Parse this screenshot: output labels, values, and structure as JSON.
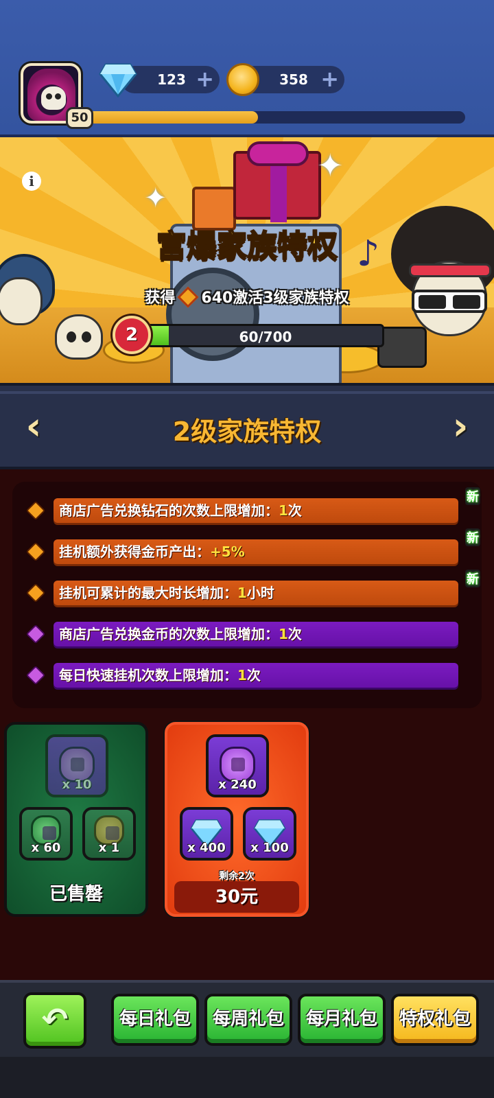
{
  "player": {
    "level": "50",
    "xp_progress": 0.45,
    "diamonds": "123",
    "coins": "358"
  },
  "banner": {
    "title": "宫爆家族特权",
    "obtain_prefix": "获得",
    "obtain_text": "640激活3级家族特权",
    "current_level": "2",
    "progress_text": "60/700",
    "progress_fraction": 0.0857
  },
  "level_header": {
    "title": "2级家族特权"
  },
  "privileges": [
    {
      "text": "商店广告兑换钻石的次数上限增加：",
      "amount": "1",
      "unit": "次",
      "color": "orange",
      "new_label": "新"
    },
    {
      "text": "挂机额外获得金币产出：",
      "amount": "+5",
      "unit": "%",
      "color": "orange",
      "new_label": "新"
    },
    {
      "text": "挂机可累计的最大时长增加：",
      "amount": "1",
      "unit": "小时",
      "color": "orange",
      "new_label": "新"
    },
    {
      "text": "商店广告兑换金币的次数上限增加：",
      "amount": "1",
      "unit": "次",
      "color": "purple",
      "new_label": ""
    },
    {
      "text": "每日快速挂机次数上限增加：",
      "amount": "1",
      "unit": "次",
      "color": "purple",
      "new_label": ""
    }
  ],
  "packs": [
    {
      "items": [
        {
          "icon": "purple-rune-icon",
          "qty": "x 10"
        },
        {
          "icon": "green-rune-icon",
          "qty": "x 60"
        },
        {
          "icon": "fast-forward-coin-icon",
          "qty": "x 1"
        }
      ],
      "status": "已售罄"
    },
    {
      "items": [
        {
          "icon": "purple-rune-icon",
          "qty": "x 240"
        },
        {
          "icon": "diamond-icon",
          "qty": "x 400"
        },
        {
          "icon": "diamond-icon",
          "qty": "x 100"
        }
      ],
      "remaining": "剩余2次",
      "price": "30元"
    }
  ],
  "nav": {
    "back_icon": "back-arrow-icon",
    "tabs": [
      "每日礼包",
      "每周礼包",
      "每月礼包",
      "特权礼包"
    ],
    "active_tab": "特权礼包"
  },
  "colors": {
    "accent_orange": "#d85a16",
    "accent_purple": "#7b1bc0",
    "title_gold": "#f8b733",
    "tab_green": "#28b332",
    "tab_active_yellow": "#f5b71c"
  }
}
